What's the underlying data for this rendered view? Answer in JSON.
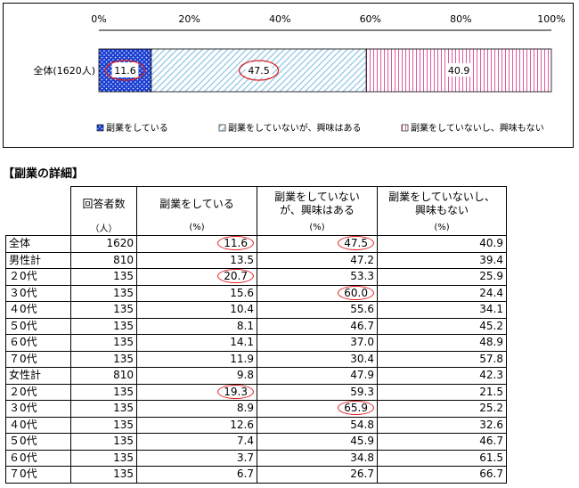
{
  "chart_data": {
    "type": "bar",
    "stacked": true,
    "orientation": "horizontal",
    "categories": [
      "全体(1620人)"
    ],
    "series": [
      {
        "name": "副業をしている",
        "values": [
          11.6
        ]
      },
      {
        "name": "副業をしていないが、興味はある",
        "values": [
          47.5
        ]
      },
      {
        "name": "副業をしていないし、興味もない",
        "values": [
          40.9
        ]
      }
    ],
    "x_ticks": [
      "0%",
      "20%",
      "40%",
      "60%",
      "80%",
      "100%"
    ],
    "xlim": [
      0,
      100
    ],
    "legend_position": "bottom",
    "highlighted_labels": [
      "11.6",
      "47.5"
    ],
    "colors": {
      "series1": "#1a3fd1",
      "series2": "#8fc6e6",
      "series3": "#e05aa0",
      "highlight": "#e02020"
    }
  },
  "detail": {
    "title": "【副業の詳細】",
    "headers": [
      "回答者数",
      "副業をしている",
      "副業をしていない\nが、興味はある",
      "副業をしていないし、\n興味もない"
    ],
    "units": [
      "（人）",
      "(%)",
      "(%)",
      "(%)"
    ],
    "rows": [
      {
        "label": "全体",
        "n": "1620",
        "a": "11.6",
        "b": "47.5",
        "c": "40.9",
        "hl": [
          "a",
          "b"
        ]
      },
      {
        "label": "男性計",
        "n": "810",
        "a": "13.5",
        "b": "47.2",
        "c": "39.4",
        "hl": []
      },
      {
        "label": "２0代",
        "n": "135",
        "a": "20.7",
        "b": "53.3",
        "c": "25.9",
        "hl": [
          "a"
        ]
      },
      {
        "label": "３0代",
        "n": "135",
        "a": "15.6",
        "b": "60.0",
        "c": "24.4",
        "hl": [
          "b"
        ]
      },
      {
        "label": "４0代",
        "n": "135",
        "a": "10.4",
        "b": "55.6",
        "c": "34.1",
        "hl": []
      },
      {
        "label": "５0代",
        "n": "135",
        "a": "8.1",
        "b": "46.7",
        "c": "45.2",
        "hl": []
      },
      {
        "label": "６0代",
        "n": "135",
        "a": "14.1",
        "b": "37.0",
        "c": "48.9",
        "hl": []
      },
      {
        "label": "７0代",
        "n": "135",
        "a": "11.9",
        "b": "30.4",
        "c": "57.8",
        "hl": []
      },
      {
        "label": "女性計",
        "n": "810",
        "a": "9.8",
        "b": "47.9",
        "c": "42.3",
        "hl": []
      },
      {
        "label": "２0代",
        "n": "135",
        "a": "19.3",
        "b": "59.3",
        "c": "21.5",
        "hl": [
          "a"
        ]
      },
      {
        "label": "３0代",
        "n": "135",
        "a": "8.9",
        "b": "65.9",
        "c": "25.2",
        "hl": [
          "b"
        ]
      },
      {
        "label": "４0代",
        "n": "135",
        "a": "12.6",
        "b": "54.8",
        "c": "32.6",
        "hl": []
      },
      {
        "label": "５0代",
        "n": "135",
        "a": "7.4",
        "b": "45.9",
        "c": "46.7",
        "hl": []
      },
      {
        "label": "６0代",
        "n": "135",
        "a": "3.7",
        "b": "34.8",
        "c": "61.5",
        "hl": []
      },
      {
        "label": "７0代",
        "n": "135",
        "a": "6.7",
        "b": "26.7",
        "c": "66.7",
        "hl": []
      }
    ]
  }
}
